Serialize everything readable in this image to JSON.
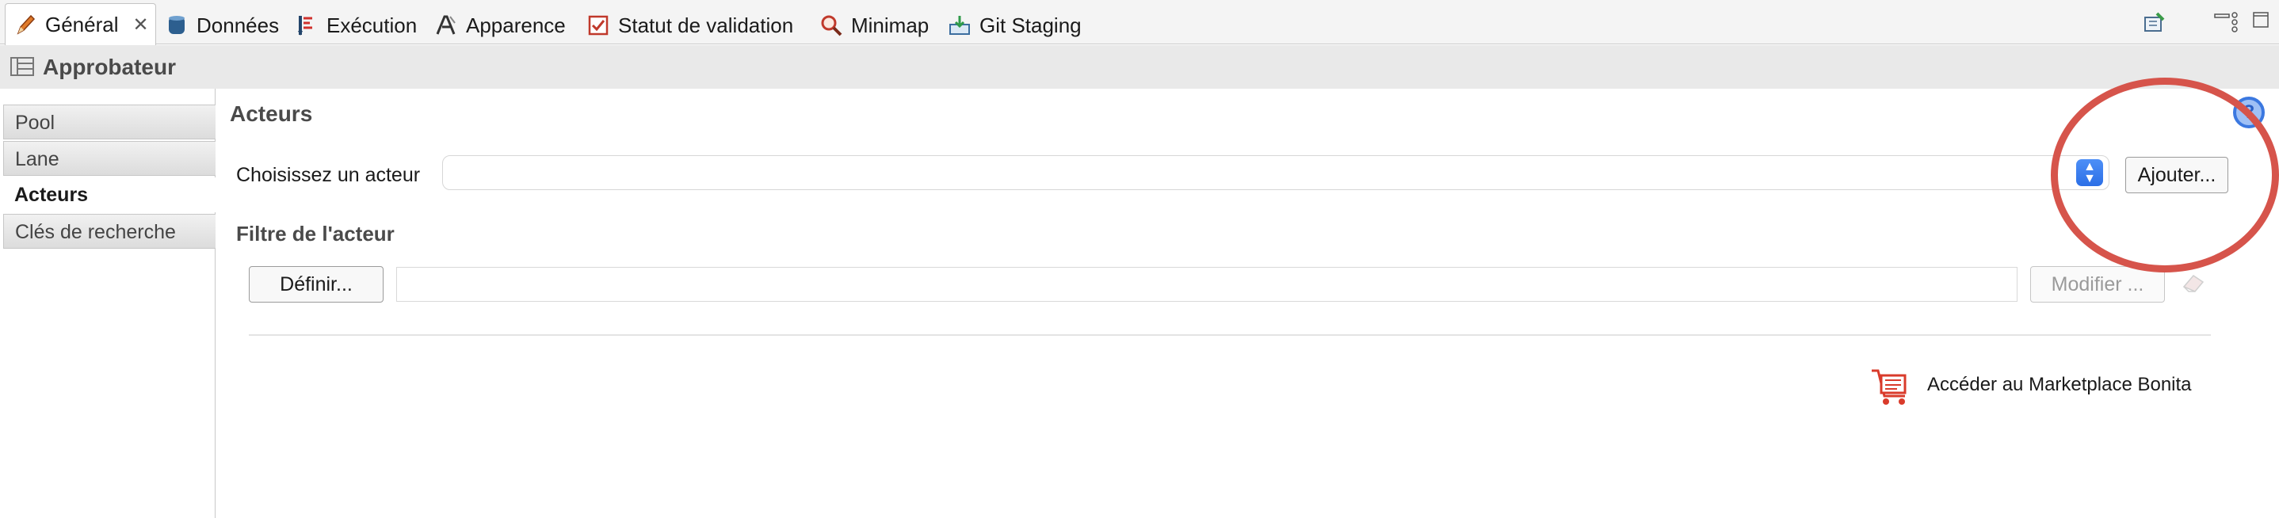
{
  "tabs": [
    {
      "label": "Général",
      "icon": "pencil-icon",
      "active": true
    },
    {
      "label": "Données",
      "icon": "database-icon"
    },
    {
      "label": "Exécution",
      "icon": "execution-flow-icon"
    },
    {
      "label": "Apparence",
      "icon": "appearance-icon"
    },
    {
      "label": "Statut de validation",
      "icon": "checkbox-validation-icon"
    },
    {
      "label": "Minimap",
      "icon": "magnifier-icon"
    },
    {
      "label": "Git Staging",
      "icon": "git-staging-icon"
    }
  ],
  "tab_close_glyph": "✕",
  "window_controls": [
    "new-view-icon",
    "view-menu-icon",
    "minimize-icon",
    "maximize-icon"
  ],
  "section": {
    "title": "Approbateur",
    "icon": "task-list-icon"
  },
  "sidebar": {
    "items": [
      {
        "label": "Pool"
      },
      {
        "label": "Lane"
      },
      {
        "label": "Acteurs",
        "selected": true
      },
      {
        "label": "Clés de recherche"
      }
    ]
  },
  "main": {
    "title": "Acteurs",
    "actor_label": "Choisissez un acteur",
    "actor_value": "",
    "add_button": "Ajouter...",
    "filter_title": "Filtre de l'acteur",
    "define_button": "Définir...",
    "filter_value": "",
    "modify_button": "Modifier ...",
    "marketplace_link": "Accéder au Marketplace Bonita"
  },
  "help_glyph": "?",
  "colors": {
    "highlight": "#d6544b",
    "accent": "#2c6fe6",
    "marketplace_icon": "#d93b2b"
  }
}
